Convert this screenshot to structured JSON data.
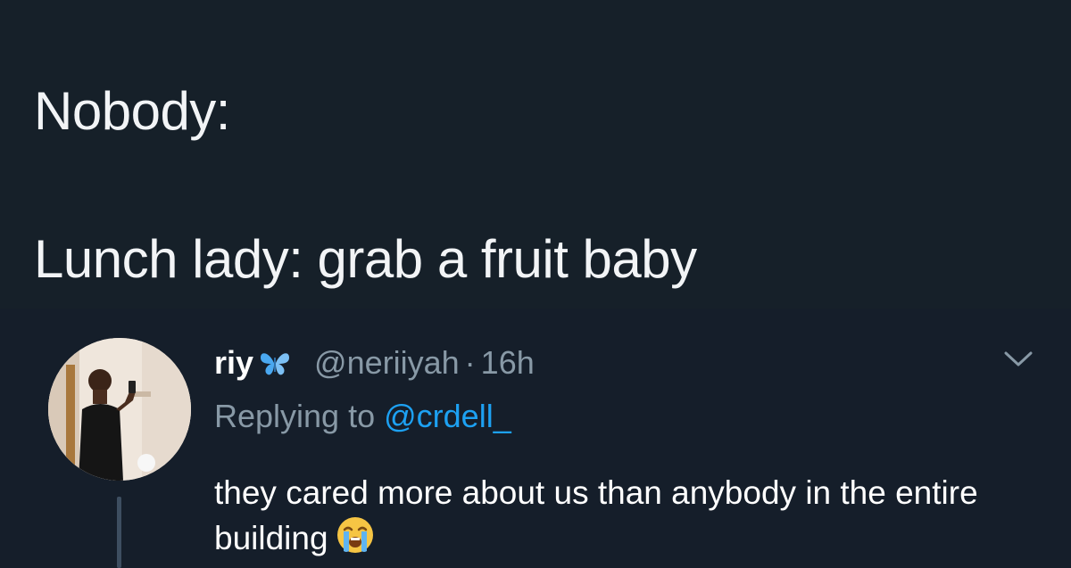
{
  "meme": {
    "line1": "Nobody:",
    "line2": "Lunch lady: grab a fruit baby"
  },
  "reply": {
    "display_name": "riy",
    "verified_icon": "butterfly-icon",
    "handle": "@neriiyah",
    "separator": "·",
    "time": "16h",
    "replying_prefix": "Replying to",
    "replying_mention": "@crdell_",
    "body_text": "they cared more about us than anybody in the entire building",
    "body_emoji": "loudly-crying-face-icon",
    "menu_icon": "chevron-down-icon"
  },
  "colors": {
    "background": "#16202b",
    "muted_text": "#8899a6",
    "link": "#1da1f2",
    "butterfly": "#4aa8f0"
  }
}
